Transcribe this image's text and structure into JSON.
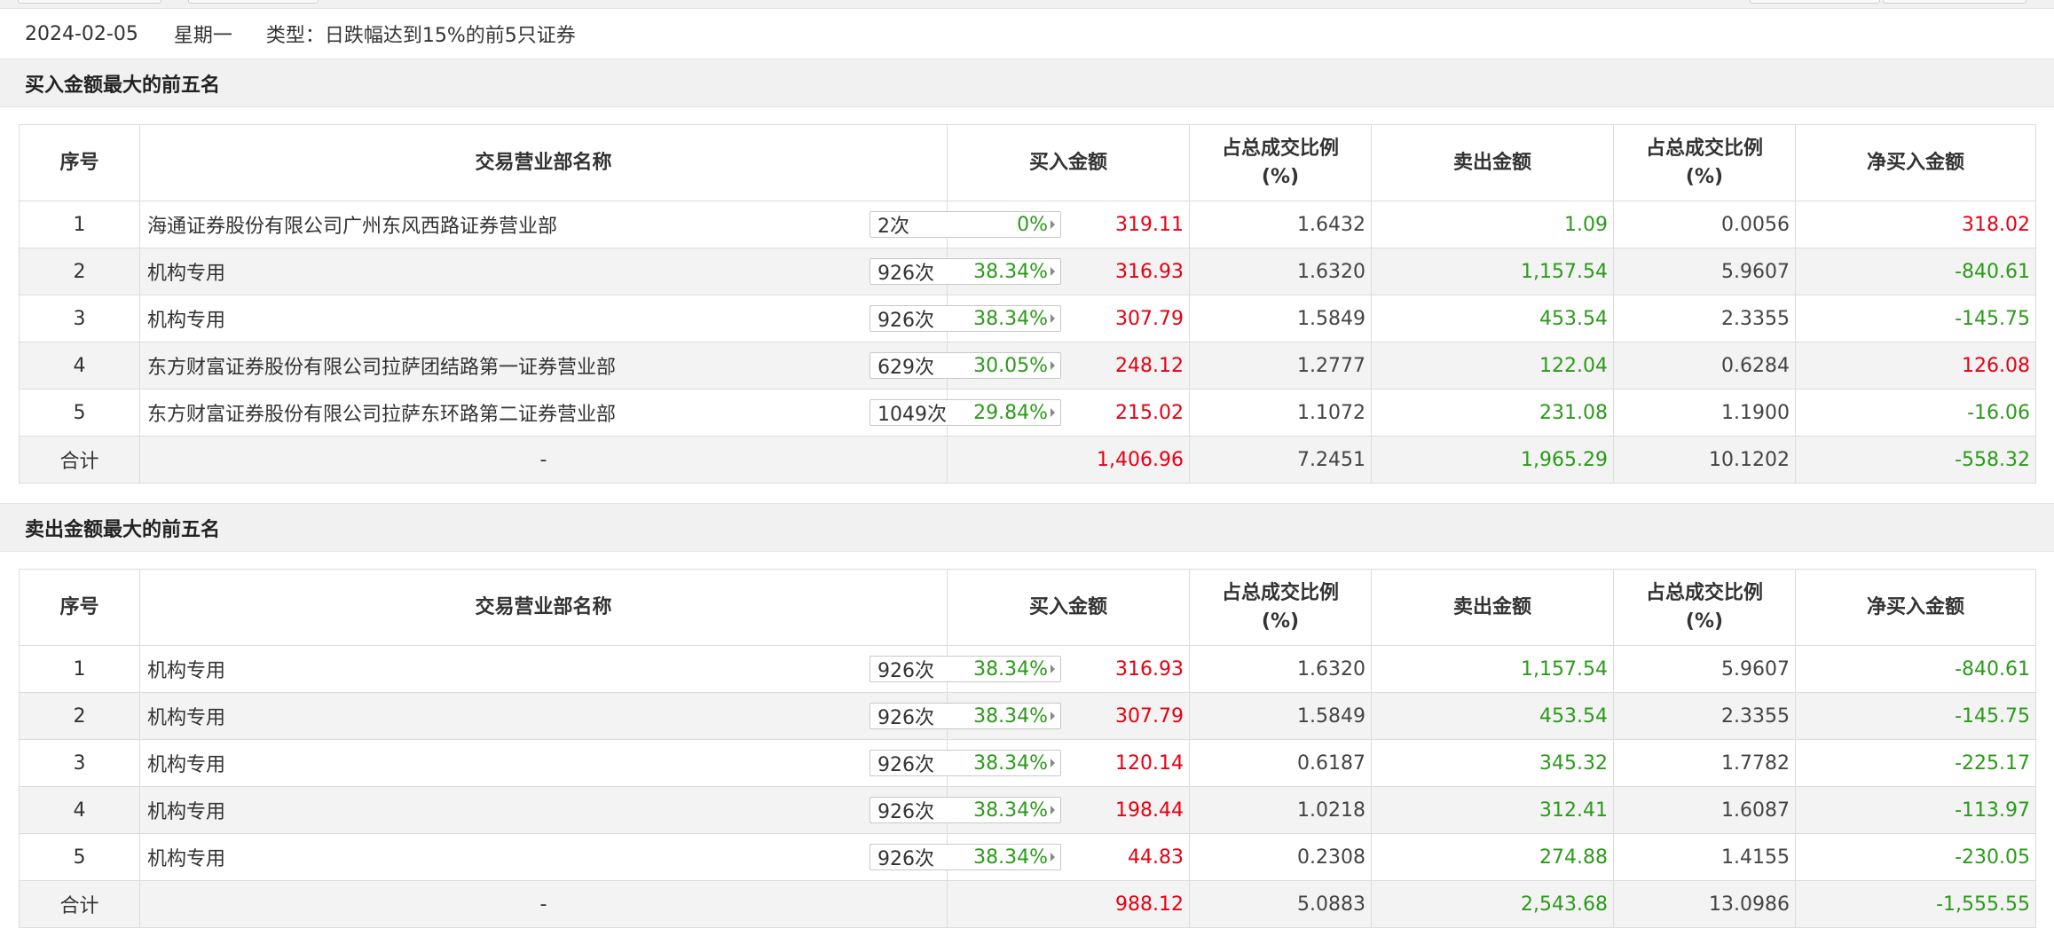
{
  "info": {
    "date": "2024-02-05",
    "weekday": "星期一",
    "type_label": "类型：",
    "type_value": "日跌幅达到15%的前5只证券"
  },
  "colors": {
    "up": "#e60012",
    "down": "#2b9a1a",
    "header_bg": "#f1f1f1"
  },
  "columns": [
    "序号",
    "交易营业部名称",
    "买入金额",
    "占总成交比例(%)",
    "卖出金额",
    "占总成交比例(%)",
    "净买入金额"
  ],
  "col_headers": {
    "seq": "序号",
    "name": "交易营业部名称",
    "buy": "买入金额",
    "buy_ratio_l1": "占总成交比例",
    "buy_ratio_l2": "(%)",
    "sell": "卖出金额",
    "sell_ratio_l1": "占总成交比例",
    "sell_ratio_l2": "(%)",
    "net": "净买入金额"
  },
  "buy_top5": {
    "title": "买入金额最大的前五名",
    "rows": [
      {
        "seq": "1",
        "name": "海通证券股份有限公司广州东风西路证券营业部",
        "count": "2次",
        "rate": "0%",
        "buy": "319.11",
        "buy_ratio": "1.6432",
        "sell": "1.09",
        "sell_ratio": "0.0056",
        "net": "318.02",
        "net_sign": "up"
      },
      {
        "seq": "2",
        "name": "机构专用",
        "count": "926次",
        "rate": "38.34%",
        "buy": "316.93",
        "buy_ratio": "1.6320",
        "sell": "1,157.54",
        "sell_ratio": "5.9607",
        "net": "-840.61",
        "net_sign": "down"
      },
      {
        "seq": "3",
        "name": "机构专用",
        "count": "926次",
        "rate": "38.34%",
        "buy": "307.79",
        "buy_ratio": "1.5849",
        "sell": "453.54",
        "sell_ratio": "2.3355",
        "net": "-145.75",
        "net_sign": "down"
      },
      {
        "seq": "4",
        "name": "东方财富证券股份有限公司拉萨团结路第一证券营业部",
        "count": "629次",
        "rate": "30.05%",
        "buy": "248.12",
        "buy_ratio": "1.2777",
        "sell": "122.04",
        "sell_ratio": "0.6284",
        "net": "126.08",
        "net_sign": "up"
      },
      {
        "seq": "5",
        "name": "东方财富证券股份有限公司拉萨东环路第二证券营业部",
        "count": "1049次",
        "rate": "29.84%",
        "buy": "215.02",
        "buy_ratio": "1.1072",
        "sell": "231.08",
        "sell_ratio": "1.1900",
        "net": "-16.06",
        "net_sign": "down"
      }
    ],
    "total": {
      "label": "合计",
      "name": "-",
      "buy": "1,406.96",
      "buy_ratio": "7.2451",
      "sell": "1,965.29",
      "sell_ratio": "10.1202",
      "net": "-558.32",
      "net_sign": "down"
    }
  },
  "sell_top5": {
    "title": "卖出金额最大的前五名",
    "rows": [
      {
        "seq": "1",
        "name": "机构专用",
        "count": "926次",
        "rate": "38.34%",
        "buy": "316.93",
        "buy_ratio": "1.6320",
        "sell": "1,157.54",
        "sell_ratio": "5.9607",
        "net": "-840.61",
        "net_sign": "down"
      },
      {
        "seq": "2",
        "name": "机构专用",
        "count": "926次",
        "rate": "38.34%",
        "buy": "307.79",
        "buy_ratio": "1.5849",
        "sell": "453.54",
        "sell_ratio": "2.3355",
        "net": "-145.75",
        "net_sign": "down"
      },
      {
        "seq": "3",
        "name": "机构专用",
        "count": "926次",
        "rate": "38.34%",
        "buy": "120.14",
        "buy_ratio": "0.6187",
        "sell": "345.32",
        "sell_ratio": "1.7782",
        "net": "-225.17",
        "net_sign": "down"
      },
      {
        "seq": "4",
        "name": "机构专用",
        "count": "926次",
        "rate": "38.34%",
        "buy": "198.44",
        "buy_ratio": "1.0218",
        "sell": "312.41",
        "sell_ratio": "1.6087",
        "net": "-113.97",
        "net_sign": "down"
      },
      {
        "seq": "5",
        "name": "机构专用",
        "count": "926次",
        "rate": "38.34%",
        "buy": "44.83",
        "buy_ratio": "0.2308",
        "sell": "274.88",
        "sell_ratio": "1.4155",
        "net": "-230.05",
        "net_sign": "down"
      }
    ],
    "total": {
      "label": "合计",
      "name": "-",
      "buy": "988.12",
      "buy_ratio": "5.0883",
      "sell": "2,543.68",
      "sell_ratio": "13.0986",
      "net": "-1,555.55",
      "net_sign": "down"
    }
  }
}
